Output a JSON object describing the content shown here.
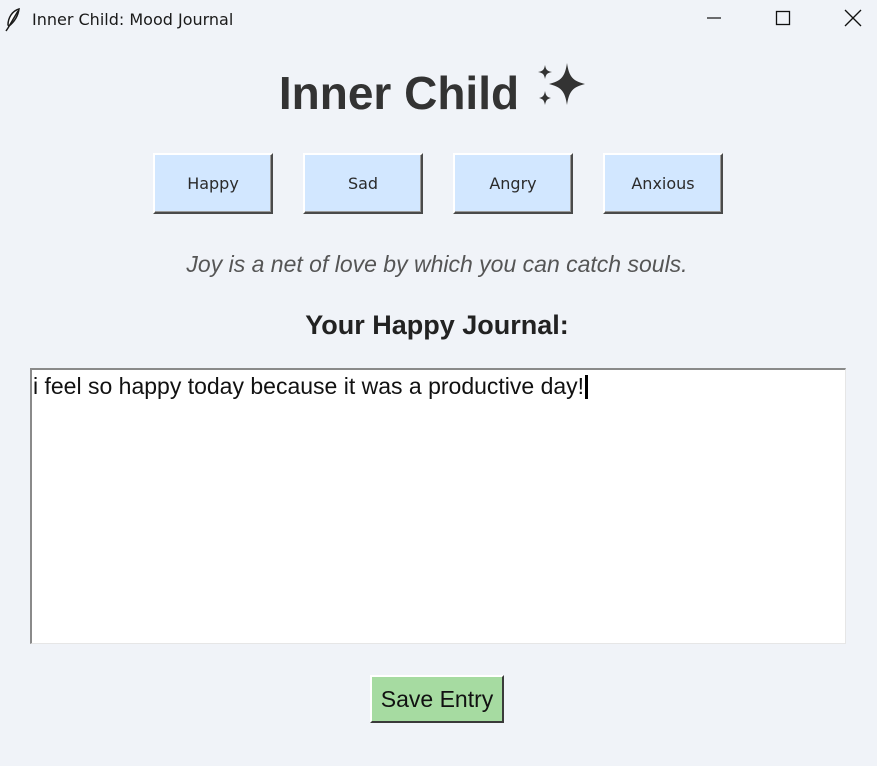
{
  "window": {
    "title": "Inner Child: Mood Journal",
    "icon": "feather-icon",
    "controls": [
      "minimize-icon",
      "maximize-icon",
      "close-icon"
    ]
  },
  "header": {
    "title": "Inner Child",
    "icon": "sparkles-icon"
  },
  "moods": [
    {
      "label": "Happy"
    },
    {
      "label": "Sad"
    },
    {
      "label": "Angry"
    },
    {
      "label": "Anxious"
    }
  ],
  "quote": "Joy is a net of love by which you can catch souls.",
  "journal": {
    "heading": "Your Happy Journal:",
    "text": "i feel so happy today because it was a productive day!"
  },
  "save_label": "Save Entry",
  "colors": {
    "background": "#f0f3f8",
    "mood_button": "#d2e7ff",
    "save_button": "#a6dba1",
    "sparkle": "#333333"
  }
}
